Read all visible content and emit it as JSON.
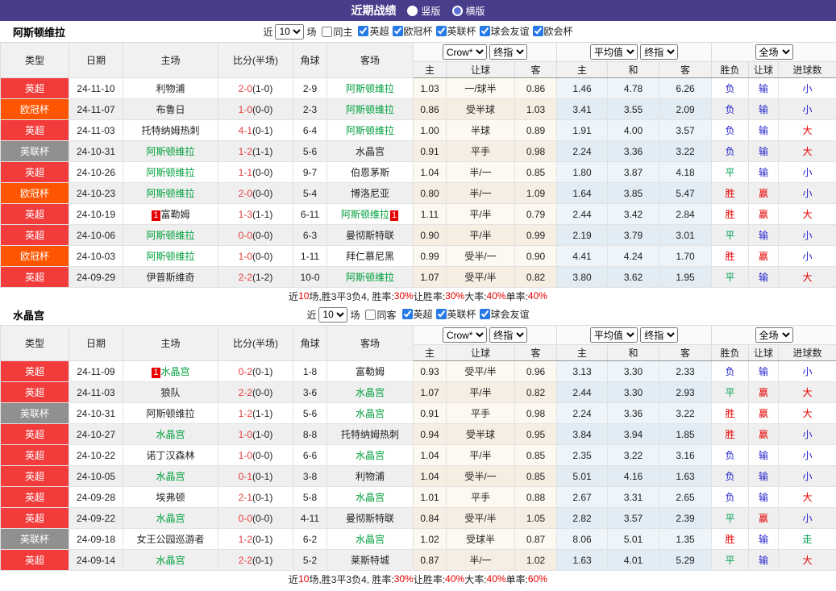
{
  "header": {
    "title": "近期战绩",
    "radios": [
      {
        "label": "竖版",
        "selected": true
      },
      {
        "label": "横版",
        "selected": false
      }
    ]
  },
  "filter": {
    "near_label": "近",
    "near_value": "10",
    "games_label": "场"
  },
  "table_header": {
    "cols": [
      "类型",
      "日期",
      "主场",
      "比分(半场)",
      "角球",
      "客场"
    ],
    "selects": {
      "company": "Crow*",
      "final": "终指",
      "average": "平均值",
      "full": "全场"
    },
    "sub": [
      "主",
      "让球",
      "客",
      "主",
      "和",
      "客",
      "胜负",
      "让球",
      "进球数"
    ]
  },
  "colors": {
    "bar_bg": "#483d8b",
    "league": {
      "英超": "#f23c3c",
      "欧冠杯": "#ff5500",
      "英联杯": "#909090"
    },
    "team_green": "#00a03c",
    "score_red": "#e63c3c",
    "result": {
      "胜": "#e60000",
      "平": "#00a050",
      "负": "#2323cc",
      "赢": "#e60000",
      "输": "#2323cc",
      "走": "#00a050",
      "大": "#e60000",
      "小": "#2323cc"
    }
  },
  "sections": [
    {
      "team": "阿斯顿维拉",
      "filter": {
        "same_label": "同主",
        "leagues": [
          "英超",
          "欧冠杯",
          "英联杯",
          "球会友谊",
          "欧会杯"
        ]
      },
      "rows": [
        {
          "league": "英超",
          "date": "24-11-10",
          "home": "利物浦",
          "home_is_team": false,
          "home_card": "",
          "score": "2-0",
          "half": "1-0",
          "corner": "2-9",
          "away": "阿斯顿维拉",
          "away_is_team": true,
          "away_card": "",
          "h": "1.03",
          "line": "一/球半",
          "a": "0.86",
          "avg_h": "1.46",
          "avg_d": "4.78",
          "avg_a": "6.26",
          "r1": "负",
          "r2": "输",
          "r3": "小"
        },
        {
          "league": "欧冠杯",
          "date": "24-11-07",
          "home": "布鲁日",
          "home_is_team": false,
          "home_card": "",
          "score": "1-0",
          "half": "0-0",
          "corner": "2-3",
          "away": "阿斯顿维拉",
          "away_is_team": true,
          "away_card": "",
          "h": "0.86",
          "line": "受半球",
          "a": "1.03",
          "avg_h": "3.41",
          "avg_d": "3.55",
          "avg_a": "2.09",
          "r1": "负",
          "r2": "输",
          "r3": "小"
        },
        {
          "league": "英超",
          "date": "24-11-03",
          "home": "托特纳姆热刺",
          "home_is_team": false,
          "home_card": "",
          "score": "4-1",
          "half": "0-1",
          "corner": "6-4",
          "away": "阿斯顿维拉",
          "away_is_team": true,
          "away_card": "",
          "h": "1.00",
          "line": "半球",
          "a": "0.89",
          "avg_h": "1.91",
          "avg_d": "4.00",
          "avg_a": "3.57",
          "r1": "负",
          "r2": "输",
          "r3": "大"
        },
        {
          "league": "英联杯",
          "date": "24-10-31",
          "home": "阿斯顿维拉",
          "home_is_team": true,
          "home_card": "",
          "score": "1-2",
          "half": "1-1",
          "corner": "5-6",
          "away": "水晶宫",
          "away_is_team": false,
          "away_card": "",
          "h": "0.91",
          "line": "平手",
          "a": "0.98",
          "avg_h": "2.24",
          "avg_d": "3.36",
          "avg_a": "3.22",
          "r1": "负",
          "r2": "输",
          "r3": "大"
        },
        {
          "league": "英超",
          "date": "24-10-26",
          "home": "阿斯顿维拉",
          "home_is_team": true,
          "home_card": "",
          "score": "1-1",
          "half": "0-0",
          "corner": "9-7",
          "away": "伯恩茅斯",
          "away_is_team": false,
          "away_card": "",
          "h": "1.04",
          "line": "半/一",
          "a": "0.85",
          "avg_h": "1.80",
          "avg_d": "3.87",
          "avg_a": "4.18",
          "r1": "平",
          "r2": "输",
          "r3": "小"
        },
        {
          "league": "欧冠杯",
          "date": "24-10-23",
          "home": "阿斯顿维拉",
          "home_is_team": true,
          "home_card": "",
          "score": "2-0",
          "half": "0-0",
          "corner": "5-4",
          "away": "博洛尼亚",
          "away_is_team": false,
          "away_card": "",
          "h": "0.80",
          "line": "半/一",
          "a": "1.09",
          "avg_h": "1.64",
          "avg_d": "3.85",
          "avg_a": "5.47",
          "r1": "胜",
          "r2": "赢",
          "r3": "小"
        },
        {
          "league": "英超",
          "date": "24-10-19",
          "home": "富勒姆",
          "home_is_team": false,
          "home_card": "1",
          "score": "1-3",
          "half": "1-1",
          "corner": "6-11",
          "away": "阿斯顿维拉",
          "away_is_team": true,
          "away_card": "1",
          "h": "1.11",
          "line": "平/半",
          "a": "0.79",
          "avg_h": "2.44",
          "avg_d": "3.42",
          "avg_a": "2.84",
          "r1": "胜",
          "r2": "赢",
          "r3": "大"
        },
        {
          "league": "英超",
          "date": "24-10-06",
          "home": "阿斯顿维拉",
          "home_is_team": true,
          "home_card": "",
          "score": "0-0",
          "half": "0-0",
          "corner": "6-3",
          "away": "曼彻斯特联",
          "away_is_team": false,
          "away_card": "",
          "h": "0.90",
          "line": "平/半",
          "a": "0.99",
          "avg_h": "2.19",
          "avg_d": "3.79",
          "avg_a": "3.01",
          "r1": "平",
          "r2": "输",
          "r3": "小"
        },
        {
          "league": "欧冠杯",
          "date": "24-10-03",
          "home": "阿斯顿维拉",
          "home_is_team": true,
          "home_card": "",
          "score": "1-0",
          "half": "0-0",
          "corner": "1-11",
          "away": "拜仁慕尼黑",
          "away_is_team": false,
          "away_card": "",
          "h": "0.99",
          "line": "受半/一",
          "a": "0.90",
          "avg_h": "4.41",
          "avg_d": "4.24",
          "avg_a": "1.70",
          "r1": "胜",
          "r2": "赢",
          "r3": "小"
        },
        {
          "league": "英超",
          "date": "24-09-29",
          "home": "伊普斯维奇",
          "home_is_team": false,
          "home_card": "",
          "score": "2-2",
          "half": "1-2",
          "corner": "10-0",
          "away": "阿斯顿维拉",
          "away_is_team": true,
          "away_card": "",
          "h": "1.07",
          "line": "受平/半",
          "a": "0.82",
          "avg_h": "3.80",
          "avg_d": "3.62",
          "avg_a": "1.95",
          "r1": "平",
          "r2": "输",
          "r3": "大"
        }
      ],
      "summary": [
        {
          "t": "近",
          "r": false
        },
        {
          "t": "10",
          "r": true
        },
        {
          "t": "场,胜3平3负4, 胜率:",
          "r": false
        },
        {
          "t": "30%",
          "r": true
        },
        {
          "t": " 让胜率:",
          "r": false
        },
        {
          "t": "30%",
          "r": true
        },
        {
          "t": " 大率:",
          "r": false
        },
        {
          "t": "40%",
          "r": true
        },
        {
          "t": " 单率:",
          "r": false
        },
        {
          "t": "40%",
          "r": true
        }
      ]
    },
    {
      "team": "水晶宫",
      "filter": {
        "same_label": "同客",
        "leagues": [
          "英超",
          "英联杯",
          "球会友谊"
        ]
      },
      "rows": [
        {
          "league": "英超",
          "date": "24-11-09",
          "home": "水晶宫",
          "home_is_team": true,
          "home_card": "1",
          "score": "0-2",
          "half": "0-1",
          "corner": "1-8",
          "away": "富勒姆",
          "away_is_team": false,
          "away_card": "",
          "h": "0.93",
          "line": "受平/半",
          "a": "0.96",
          "avg_h": "3.13",
          "avg_d": "3.30",
          "avg_a": "2.33",
          "r1": "负",
          "r2": "输",
          "r3": "小"
        },
        {
          "league": "英超",
          "date": "24-11-03",
          "home": "狼队",
          "home_is_team": false,
          "home_card": "",
          "score": "2-2",
          "half": "0-0",
          "corner": "3-6",
          "away": "水晶宫",
          "away_is_team": true,
          "away_card": "",
          "h": "1.07",
          "line": "平/半",
          "a": "0.82",
          "avg_h": "2.44",
          "avg_d": "3.30",
          "avg_a": "2.93",
          "r1": "平",
          "r2": "赢",
          "r3": "大"
        },
        {
          "league": "英联杯",
          "date": "24-10-31",
          "home": "阿斯顿维拉",
          "home_is_team": false,
          "home_card": "",
          "score": "1-2",
          "half": "1-1",
          "corner": "5-6",
          "away": "水晶宫",
          "away_is_team": true,
          "away_card": "",
          "h": "0.91",
          "line": "平手",
          "a": "0.98",
          "avg_h": "2.24",
          "avg_d": "3.36",
          "avg_a": "3.22",
          "r1": "胜",
          "r2": "赢",
          "r3": "大"
        },
        {
          "league": "英超",
          "date": "24-10-27",
          "home": "水晶宫",
          "home_is_team": true,
          "home_card": "",
          "score": "1-0",
          "half": "1-0",
          "corner": "8-8",
          "away": "托特纳姆热刺",
          "away_is_team": false,
          "away_card": "",
          "h": "0.94",
          "line": "受半球",
          "a": "0.95",
          "avg_h": "3.84",
          "avg_d": "3.94",
          "avg_a": "1.85",
          "r1": "胜",
          "r2": "赢",
          "r3": "小"
        },
        {
          "league": "英超",
          "date": "24-10-22",
          "home": "诺丁汉森林",
          "home_is_team": false,
          "home_card": "",
          "score": "1-0",
          "half": "0-0",
          "corner": "6-6",
          "away": "水晶宫",
          "away_is_team": true,
          "away_card": "",
          "h": "1.04",
          "line": "平/半",
          "a": "0.85",
          "avg_h": "2.35",
          "avg_d": "3.22",
          "avg_a": "3.16",
          "r1": "负",
          "r2": "输",
          "r3": "小"
        },
        {
          "league": "英超",
          "date": "24-10-05",
          "home": "水晶宫",
          "home_is_team": true,
          "home_card": "",
          "score": "0-1",
          "half": "0-1",
          "corner": "3-8",
          "away": "利物浦",
          "away_is_team": false,
          "away_card": "",
          "h": "1.04",
          "line": "受半/一",
          "a": "0.85",
          "avg_h": "5.01",
          "avg_d": "4.16",
          "avg_a": "1.63",
          "r1": "负",
          "r2": "输",
          "r3": "小"
        },
        {
          "league": "英超",
          "date": "24-09-28",
          "home": "埃弗顿",
          "home_is_team": false,
          "home_card": "",
          "score": "2-1",
          "half": "0-1",
          "corner": "5-8",
          "away": "水晶宫",
          "away_is_team": true,
          "away_card": "",
          "h": "1.01",
          "line": "平手",
          "a": "0.88",
          "avg_h": "2.67",
          "avg_d": "3.31",
          "avg_a": "2.65",
          "r1": "负",
          "r2": "输",
          "r3": "大"
        },
        {
          "league": "英超",
          "date": "24-09-22",
          "home": "水晶宫",
          "home_is_team": true,
          "home_card": "",
          "score": "0-0",
          "half": "0-0",
          "corner": "4-11",
          "away": "曼彻斯特联",
          "away_is_team": false,
          "away_card": "",
          "h": "0.84",
          "line": "受平/半",
          "a": "1.05",
          "avg_h": "2.82",
          "avg_d": "3.57",
          "avg_a": "2.39",
          "r1": "平",
          "r2": "赢",
          "r3": "小"
        },
        {
          "league": "英联杯",
          "date": "24-09-18",
          "home": "女王公园巡游者",
          "home_is_team": false,
          "home_card": "",
          "score": "1-2",
          "half": "0-1",
          "corner": "6-2",
          "away": "水晶宫",
          "away_is_team": true,
          "away_card": "",
          "h": "1.02",
          "line": "受球半",
          "a": "0.87",
          "avg_h": "8.06",
          "avg_d": "5.01",
          "avg_a": "1.35",
          "r1": "胜",
          "r2": "输",
          "r3": "走"
        },
        {
          "league": "英超",
          "date": "24-09-14",
          "home": "水晶宫",
          "home_is_team": true,
          "home_card": "",
          "score": "2-2",
          "half": "0-1",
          "corner": "5-2",
          "away": "莱斯特城",
          "away_is_team": false,
          "away_card": "",
          "h": "0.87",
          "line": "半/一",
          "a": "1.02",
          "avg_h": "1.63",
          "avg_d": "4.01",
          "avg_a": "5.29",
          "r1": "平",
          "r2": "输",
          "r3": "大"
        }
      ],
      "summary": [
        {
          "t": "近",
          "r": false
        },
        {
          "t": "10",
          "r": true
        },
        {
          "t": "场,胜3平3负4, 胜率:",
          "r": false
        },
        {
          "t": "30%",
          "r": true
        },
        {
          "t": " 让胜率:",
          "r": false
        },
        {
          "t": "40%",
          "r": true
        },
        {
          "t": " 大率:",
          "r": false
        },
        {
          "t": "40%",
          "r": true
        },
        {
          "t": " 单率:",
          "r": false
        },
        {
          "t": "60%",
          "r": true
        }
      ]
    }
  ]
}
